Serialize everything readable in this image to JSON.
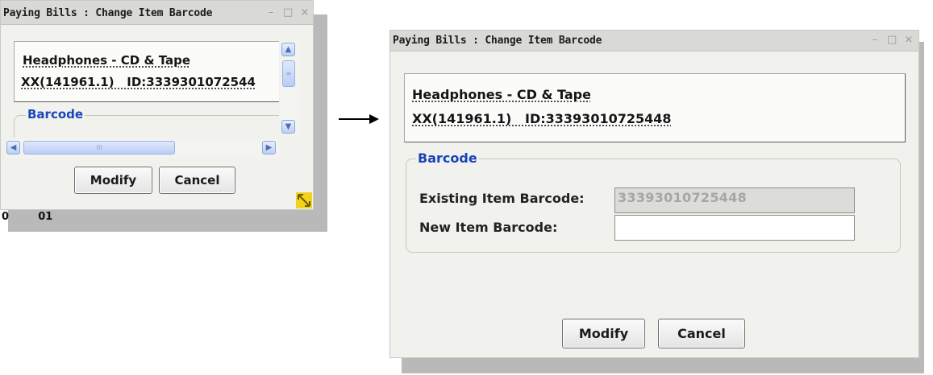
{
  "left_window": {
    "title": "Paying Bills : Change Item Barcode",
    "item_name": "Headphones - CD & Tape",
    "item_id": "XX(141961.1)   ID:3339301072544",
    "barcode_legend": "Barcode",
    "modify_label": "Modify",
    "cancel_label": "Cancel",
    "window_controls": [
      "–",
      "□",
      "×"
    ],
    "scroll_thumb_grip": "III",
    "background_fragment": "0        01"
  },
  "arrow": "→",
  "right_window": {
    "title": "Paying Bills : Change Item Barcode",
    "item_name": "Headphones - CD & Tape",
    "item_id": "XX(141961.1)   ID:33393010725448",
    "barcode_legend": "Barcode",
    "existing_barcode_label": "Existing Item Barcode:",
    "existing_barcode_value": "33393010725448",
    "new_barcode_label": "New Item Barcode:",
    "new_barcode_value": "",
    "modify_label": "Modify",
    "cancel_label": "Cancel",
    "window_controls": [
      "–",
      "□",
      "×"
    ]
  }
}
